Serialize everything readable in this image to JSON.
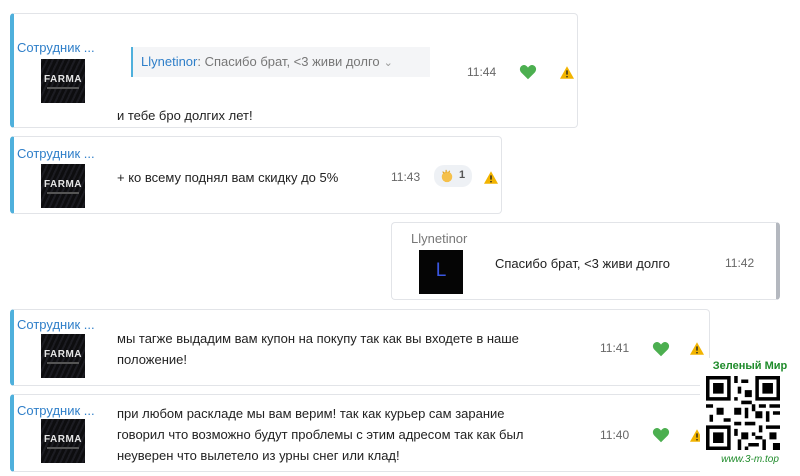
{
  "colors": {
    "author": "#2f7fc9",
    "accent_border": "#4fb0dc",
    "heart": "#4caf50",
    "warning": "#f2b400",
    "ad_green": "#1e8b2a"
  },
  "messages": [
    {
      "author": "Сотрудник ...",
      "reply_to": {
        "name": "Llynetinor",
        "text": "Спасибо брат, <3 живи долго",
        "chevron": "⌄"
      },
      "text": "и тебе бро долгих лет!",
      "time": "11:44",
      "icons": [
        "heart-icon",
        "warning-icon"
      ]
    },
    {
      "author": "Сотрудник ...",
      "text": "+ ко всему поднял вам скидку до 5%",
      "time": "11:43",
      "reaction": {
        "emoji": "clap-icon",
        "count": "1"
      },
      "icons": [
        "warning-icon"
      ]
    },
    {
      "author": "Llynetinor",
      "avatar_letter": "L",
      "text": "Спасибо брат, <3 живи долго",
      "time": "11:42",
      "outgoing": true
    },
    {
      "author": "Сотрудник ...",
      "text_lines": [
        "мы тагже выдадим вам купон на покупу так как вы входете в наше",
        "положение!"
      ],
      "time": "11:41",
      "icons": [
        "heart-icon",
        "warning-icon"
      ]
    },
    {
      "author": "Сотрудник ...",
      "text_lines": [
        "при любом раскладе мы вам верим! так как курьер сам зарание",
        "говорил что возможно будут проблемы с этим адресом так как был",
        "неуверен что вылетело из урны снег или клад!"
      ],
      "time": "11:40",
      "icons": [
        "heart-icon",
        "warning-icon"
      ]
    }
  ],
  "avatar_logo": "FARMA",
  "ad": {
    "title": "Зеленый Мир",
    "url": "www.3-m.top",
    "icon": "qr-code-icon"
  }
}
